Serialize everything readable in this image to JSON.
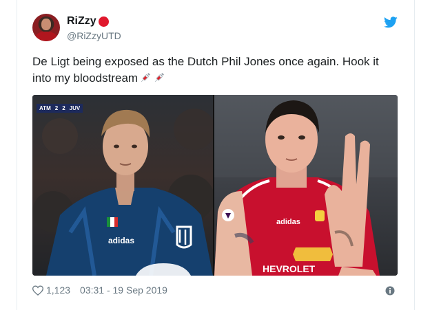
{
  "author": {
    "name": "RiZzy",
    "handle": "@RiZzyUTD"
  },
  "tweet": {
    "text": "De Ligt being exposed as the Dutch Phil Jones once again. Hook it into my bloodstream",
    "emojis": [
      "syringe-icon",
      "syringe-icon"
    ]
  },
  "media": {
    "left_photo": {
      "scoreboard": {
        "home": "ATM",
        "home_score": "2",
        "away_score": "2",
        "away": "JUV"
      }
    },
    "right_photo": {
      "shirt_sponsor": "HEVROLET"
    }
  },
  "footer": {
    "likes": "1,123",
    "timestamp": "03:31 - 19 Sep 2019"
  },
  "colors": {
    "twitter_blue": "#1da1f2",
    "text": "#1c2022",
    "muted": "#697882",
    "status_dot": "#e0182d"
  }
}
